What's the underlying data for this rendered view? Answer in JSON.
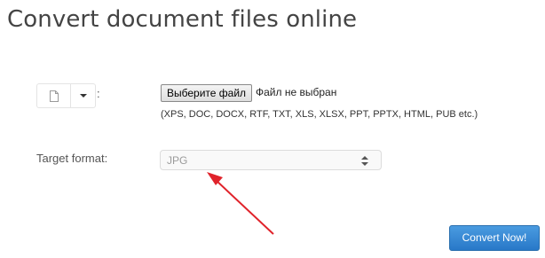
{
  "page": {
    "title": "Convert document files online"
  },
  "source": {
    "colon": ":",
    "file_icon": "file-icon",
    "dropdown_icon": "caret-down-icon"
  },
  "file_input": {
    "button_label": "Выберите файл",
    "status_text": "Файл не выбран",
    "formats_hint": "(XPS, DOC, DOCX, RTF, TXT, XLS, XLSX, PPT, PPTX, HTML, PUB etc.)"
  },
  "target": {
    "label": "Target format:",
    "selected_value": "JPG",
    "select_icon": "updown-arrows-icon"
  },
  "annotation": {
    "icon": "red-arrow-icon",
    "color": "#e0232b"
  },
  "actions": {
    "convert_label": "Convert Now!",
    "convert_color": "#2e80cf"
  }
}
